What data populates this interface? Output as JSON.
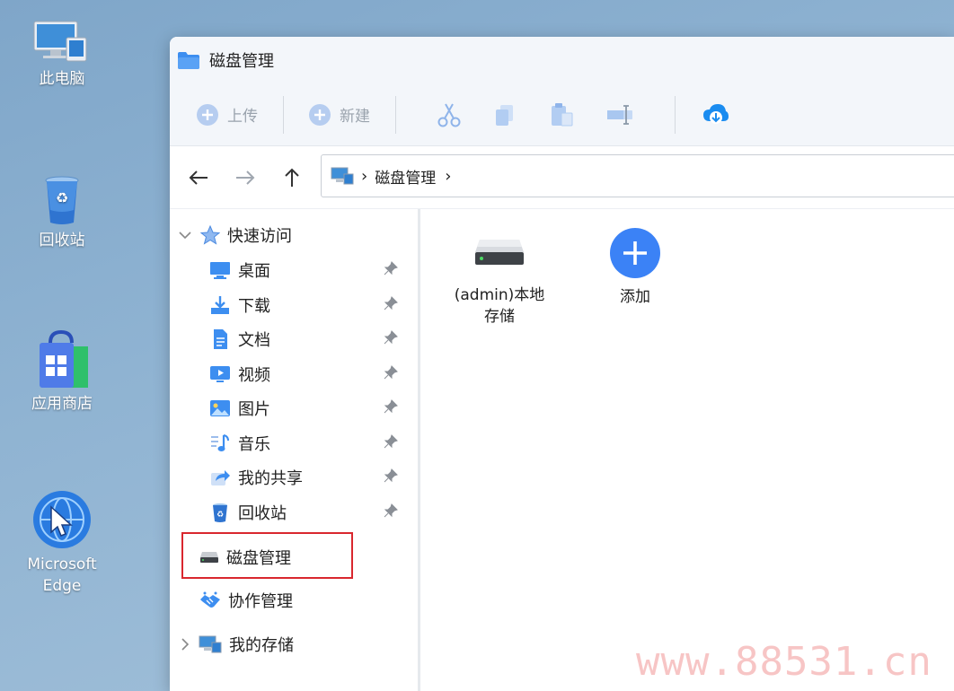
{
  "desktop": {
    "icons": [
      {
        "label": "此电脑",
        "icon": "computer-icon"
      },
      {
        "label": "回收站",
        "icon": "recycle-bin-icon"
      },
      {
        "label": "应用商店",
        "icon": "app-store-icon"
      },
      {
        "label": "Microsoft Edge",
        "icon": "edge-icon"
      }
    ]
  },
  "window": {
    "title": "磁盘管理",
    "toolbar": {
      "upload": "上传",
      "new": "新建"
    },
    "address": {
      "crumb": "磁盘管理"
    },
    "sidebar": {
      "quick_access": "快速访问",
      "items": [
        {
          "label": "桌面",
          "icon": "desktop-icon"
        },
        {
          "label": "下载",
          "icon": "download-icon"
        },
        {
          "label": "文档",
          "icon": "document-icon"
        },
        {
          "label": "视频",
          "icon": "video-icon"
        },
        {
          "label": "图片",
          "icon": "picture-icon"
        },
        {
          "label": "音乐",
          "icon": "music-icon"
        },
        {
          "label": "我的共享",
          "icon": "share-icon"
        },
        {
          "label": "回收站",
          "icon": "recycle-bin-icon"
        }
      ],
      "disk_management": "磁盘管理",
      "collab_management": "协作管理",
      "my_storage": "我的存储"
    },
    "content": {
      "tiles": [
        {
          "label": "(admin)本地存储",
          "icon": "drive-icon"
        },
        {
          "label": "添加",
          "icon": "add-icon"
        }
      ]
    }
  },
  "watermark": "www.88531.cn",
  "colors": {
    "accent": "#3b82f6",
    "highlight_border": "#d9272e",
    "toolbar_disabled": "#9aa3ad"
  }
}
